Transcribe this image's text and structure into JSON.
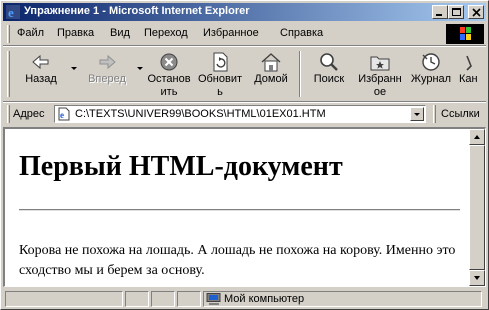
{
  "window": {
    "title": "Упражнение 1 - Microsoft Internet Explorer"
  },
  "menu": [
    {
      "label": "Файл"
    },
    {
      "label": "Правка"
    },
    {
      "label": "Вид"
    },
    {
      "label": "Переход"
    },
    {
      "label": "Избранное"
    },
    {
      "label": "Справка"
    }
  ],
  "toolbar": {
    "back": {
      "label": "Назад"
    },
    "forward": {
      "label": "Вперед"
    },
    "stop": {
      "label_line1": "Останов",
      "label_line2": "ить"
    },
    "refresh": {
      "label_line1": "Обновит",
      "label_line2": "ь"
    },
    "home": {
      "label": "Домой"
    },
    "search": {
      "label": "Поиск"
    },
    "favorites": {
      "label_line1": "Избранн",
      "label_line2": "ое"
    },
    "history": {
      "label": "Журнал"
    },
    "channels": {
      "label": "Кан"
    }
  },
  "address": {
    "label": "Адрес",
    "value": "C:\\TEXTS\\UNIVER99\\BOOKS\\HTML\\01EX01.HTM",
    "links_label": "Ссылки"
  },
  "page": {
    "heading": "Первый HTML-документ",
    "paragraph": "Корова не похожа на лошадь. А лошадь не похожа на корову. Именно это сходство мы и берем за основу."
  },
  "status": {
    "zone": "Мой компьютер"
  },
  "colors": {
    "titlebar_start": "#0a246a",
    "titlebar_end": "#a6caf0",
    "chrome": "#d4d0c8"
  }
}
